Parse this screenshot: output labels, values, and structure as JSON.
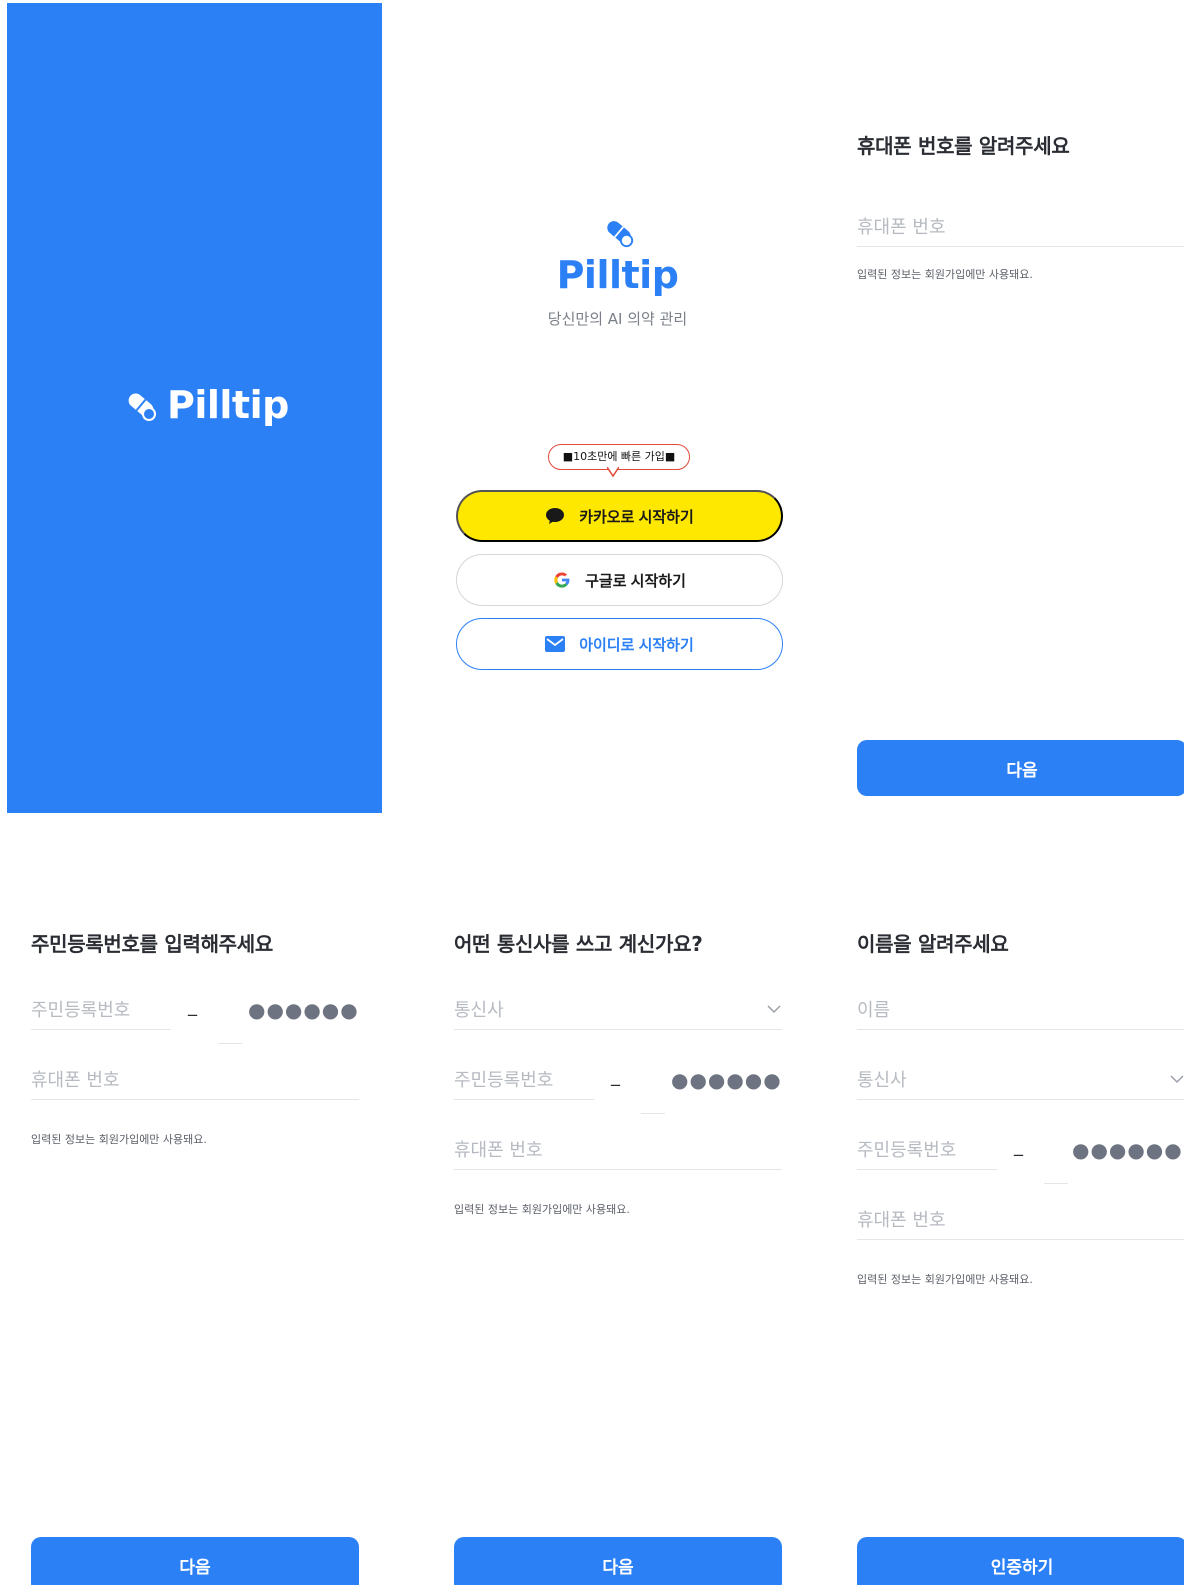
{
  "splash": {
    "brand": "Pilltip"
  },
  "login": {
    "brand": "Pilltip",
    "tagline": "당신만의 AI 의약 관리",
    "bubble": "■10초만에 빠른 가입■",
    "kakao_label": "카카오로 시작하기",
    "google_label": "구글로 시작하기",
    "id_label": "아이디로 시작하기",
    "colors": {
      "primary": "#2b80f5",
      "kakao": "#ffe800"
    }
  },
  "phone_step": {
    "title": "휴대폰 번호를 알려주세요",
    "phone_placeholder": "휴대폰 번호",
    "hint": "입력된 정보는 회원가입에만 사용돼요.",
    "next_label": "다음"
  },
  "rrn_step": {
    "title": "주민등록번호를 입력해주세요",
    "rrn_placeholder": "주민등록번호",
    "dash": "_",
    "masked": "●●●●●●",
    "phone_placeholder": "휴대폰 번호",
    "hint": "입력된 정보는 회원가입에만 사용돼요.",
    "next_label": "다음"
  },
  "carrier_step": {
    "title": "어떤 통신사를 쓰고 계신가요?",
    "carrier_placeholder": "통신사",
    "rrn_placeholder": "주민등록번호",
    "dash": "_",
    "masked": "●●●●●●",
    "phone_placeholder": "휴대폰 번호",
    "hint": "입력된 정보는 회원가입에만 사용돼요.",
    "next_label": "다음"
  },
  "name_step": {
    "title": "이름을 알려주세요",
    "name_placeholder": "이름",
    "carrier_placeholder": "통신사",
    "rrn_placeholder": "주민등록번호",
    "dash": "_",
    "masked": "●●●●●●",
    "phone_placeholder": "휴대폰 번호",
    "hint": "입력된 정보는 회원가입에만 사용돼요.",
    "verify_label": "인증하기"
  }
}
